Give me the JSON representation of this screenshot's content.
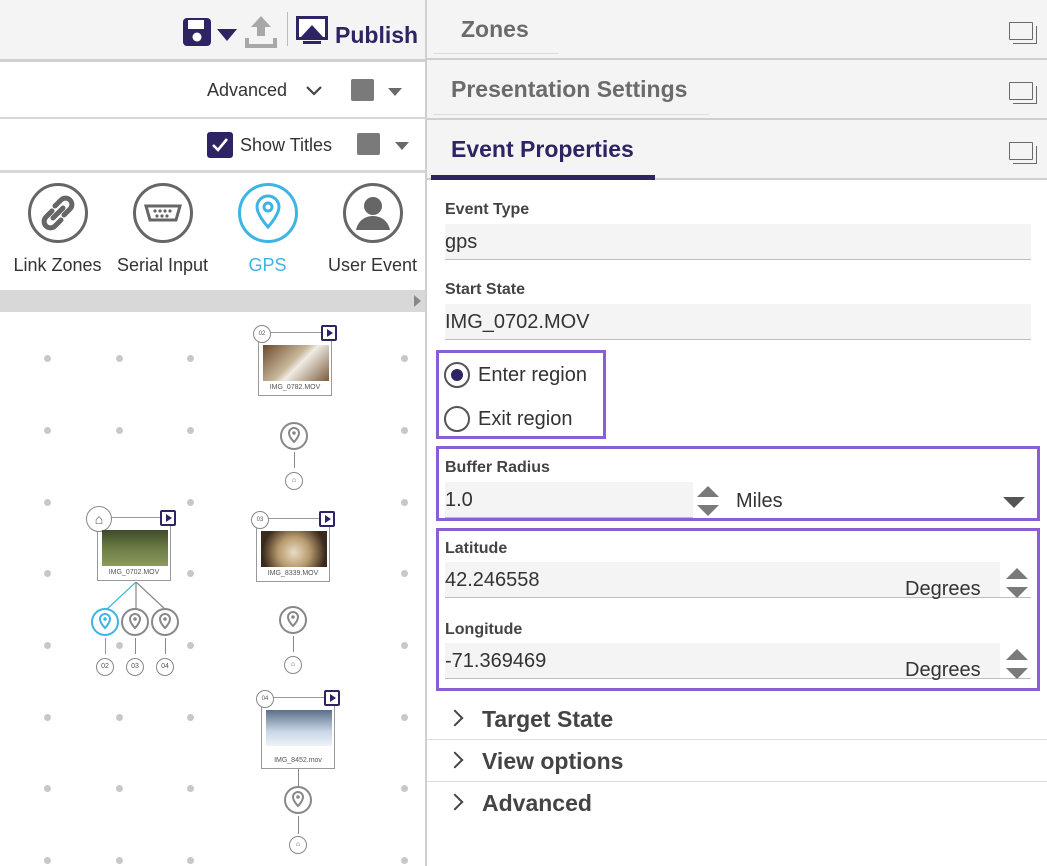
{
  "toolbar": {
    "publish_label": "Publish"
  },
  "filters": {
    "advanced_label": "Advanced",
    "show_titles_label": "Show Titles",
    "show_titles_checked": true
  },
  "event_types": [
    {
      "label": "Link Zones",
      "icon": "link-icon",
      "active": false
    },
    {
      "label": "Serial Input",
      "icon": "serial-port-icon",
      "active": false
    },
    {
      "label": "GPS",
      "icon": "map-pin-icon",
      "active": true
    },
    {
      "label": "User Event",
      "icon": "user-icon",
      "active": false
    }
  ],
  "canvas": {
    "nodes": [
      {
        "number": "02",
        "caption": "IMG_0782.MOV"
      },
      {
        "number": "",
        "caption": "IMG_0702.MOV"
      },
      {
        "number": "03",
        "caption": "IMG_8339.MOV"
      },
      {
        "number": "04",
        "caption": "IMG_8452.mov"
      }
    ],
    "branch_labels": [
      "02",
      "03",
      "04"
    ]
  },
  "panels": {
    "zones_title": "Zones",
    "presentation_title": "Presentation Settings",
    "event_properties_title": "Event Properties"
  },
  "event_properties": {
    "event_type_label": "Event Type",
    "event_type_value": "gps",
    "start_state_label": "Start State",
    "start_state_value": "IMG_0702.MOV",
    "enter_region_label": "Enter region",
    "exit_region_label": "Exit region",
    "selected_region": "enter",
    "buffer_radius_label": "Buffer Radius",
    "buffer_radius_value": "1.0",
    "buffer_radius_unit": "Miles",
    "latitude_label": "Latitude",
    "latitude_value": "42.246558",
    "latitude_unit": "Degrees",
    "longitude_label": "Longitude",
    "longitude_value": "-71.369469",
    "longitude_unit": "Degrees"
  },
  "accordion": [
    {
      "label": "Target State"
    },
    {
      "label": "View options"
    },
    {
      "label": "Advanced"
    }
  ],
  "colors": {
    "brand": "#2e2363",
    "active_blue": "#3cb4e6",
    "highlight": "#8a5fd6"
  }
}
